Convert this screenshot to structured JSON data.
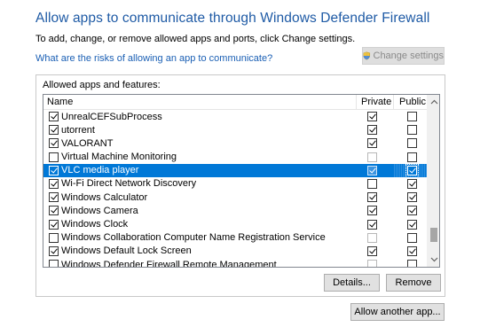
{
  "header": {
    "title": "Allow apps to communicate through Windows Defender Firewall",
    "subtitle": "To add, change, or remove allowed apps and ports, click Change settings.",
    "risk_link": "What are the risks of allowing an app to communicate?",
    "change_settings_label": "Change settings"
  },
  "group": {
    "label": "Allowed apps and features:",
    "columns": {
      "name": "Name",
      "private": "Private",
      "public": "Public"
    },
    "rows": [
      {
        "name": "UnrealCEFSubProcess",
        "enabled": true,
        "private": true,
        "public": false,
        "selected": false
      },
      {
        "name": "utorrent",
        "enabled": true,
        "private": true,
        "public": false,
        "selected": false
      },
      {
        "name": "VALORANT",
        "enabled": true,
        "private": true,
        "public": false,
        "selected": false
      },
      {
        "name": "Virtual Machine Monitoring",
        "enabled": false,
        "private": false,
        "public": false,
        "selected": false
      },
      {
        "name": "VLC media player",
        "enabled": true,
        "private": true,
        "public": true,
        "selected": true
      },
      {
        "name": "Wi-Fi Direct Network Discovery",
        "enabled": true,
        "private": false,
        "public": true,
        "selected": false
      },
      {
        "name": "Windows Calculator",
        "enabled": true,
        "private": true,
        "public": true,
        "selected": false
      },
      {
        "name": "Windows Camera",
        "enabled": true,
        "private": true,
        "public": true,
        "selected": false
      },
      {
        "name": "Windows Clock",
        "enabled": true,
        "private": true,
        "public": true,
        "selected": false
      },
      {
        "name": "Windows Collaboration Computer Name Registration Service",
        "enabled": false,
        "private": false,
        "public": false,
        "selected": false
      },
      {
        "name": "Windows Default Lock Screen",
        "enabled": true,
        "private": true,
        "public": true,
        "selected": false
      },
      {
        "name": "Windows Defender Firewall Remote Management",
        "enabled": false,
        "private": false,
        "public": false,
        "selected": false
      }
    ],
    "details_label": "Details...",
    "remove_label": "Remove"
  },
  "footer": {
    "allow_another_label": "Allow another app..."
  },
  "colors": {
    "title": "#1e5aa5",
    "link": "#1a5fb4",
    "selection": "#0078d7"
  },
  "icons": {
    "change_settings": "shield-icon",
    "scroll_up": "chevron-up-icon",
    "scroll_down": "chevron-down-icon"
  }
}
